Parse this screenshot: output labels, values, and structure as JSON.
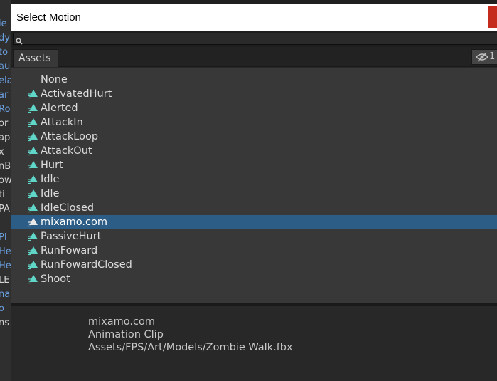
{
  "window": {
    "title": "Select Motion"
  },
  "background_inspector": {
    "fragments": [
      "ie",
      "dy",
      "to",
      "au",
      "ela",
      "ar",
      "Ro",
      "or",
      "ap",
      "x",
      "nB",
      "ow",
      "ti",
      "PA",
      "",
      "PI",
      "He",
      "He",
      "LE",
      "na",
      "o",
      "ns"
    ]
  },
  "search": {
    "value": "",
    "placeholder": ""
  },
  "tabs": {
    "assets_label": "Assets",
    "hidden_count": "1"
  },
  "colors": {
    "selection": "#2c5d87",
    "motion_icon": "#5fd6c8",
    "close_button": "#c42b1c",
    "link_text": "#6a9fe0"
  },
  "items": [
    {
      "label": "None",
      "icon": "none",
      "selected": false
    },
    {
      "label": "ActivatedHurt",
      "icon": "animation-clip-icon",
      "selected": false
    },
    {
      "label": "Alerted",
      "icon": "animation-clip-icon",
      "selected": false
    },
    {
      "label": "AttackIn",
      "icon": "animation-clip-icon",
      "selected": false
    },
    {
      "label": "AttackLoop",
      "icon": "animation-clip-icon",
      "selected": false
    },
    {
      "label": "AttackOut",
      "icon": "animation-clip-icon",
      "selected": false
    },
    {
      "label": "Hurt",
      "icon": "animation-clip-icon",
      "selected": false
    },
    {
      "label": "Idle",
      "icon": "animation-clip-icon",
      "selected": false
    },
    {
      "label": "Idle",
      "icon": "animation-clip-icon",
      "selected": false
    },
    {
      "label": "IdleClosed",
      "icon": "animation-clip-icon",
      "selected": false
    },
    {
      "label": "mixamo.com",
      "icon": "animation-clip-icon",
      "selected": true
    },
    {
      "label": "PassiveHurt",
      "icon": "animation-clip-icon",
      "selected": false
    },
    {
      "label": "RunFoward",
      "icon": "animation-clip-icon",
      "selected": false
    },
    {
      "label": "RunFowardClosed",
      "icon": "animation-clip-icon",
      "selected": false
    },
    {
      "label": "Shoot",
      "icon": "animation-clip-icon",
      "selected": false
    }
  ],
  "preview": {
    "name": "mixamo.com",
    "type": "Animation Clip",
    "path": "Assets/FPS/Art/Models/Zombie Walk.fbx"
  }
}
